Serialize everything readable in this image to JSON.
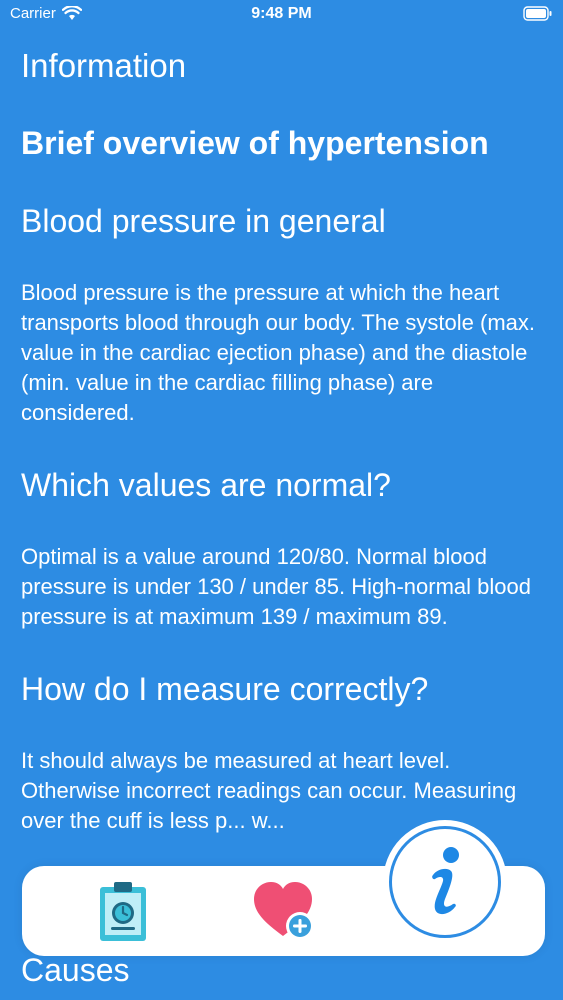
{
  "status_bar": {
    "carrier": "Carrier",
    "time": "9:48 PM",
    "wifi_icon": "wifi-icon",
    "battery_icon": "battery-icon"
  },
  "page": {
    "title": "Information",
    "subtitle": "Brief overview of hypertension",
    "sections": [
      {
        "heading": "Blood pressure in general",
        "text": "Blood pressure is the pressure at which the heart transports blood through our body. The systole (max. value in the cardiac ejection phase) and the diastole (min. value in the cardiac filling phase) are considered."
      },
      {
        "heading": "Which values are normal?",
        "text": "Optimal is a value around 120/80. Normal blood pressure is under 130 / under 85. High-normal blood pressure is at maximum 139 / maximum 89."
      },
      {
        "heading": "How do I measure correctly?",
        "text": "It should always be measured at heart level. Otherwise incorrect readings can occur. Measuring over the cuff is less p... w..."
      }
    ],
    "next_heading": "Causes"
  },
  "tab_bar": {
    "items": [
      {
        "icon": "clipboard-clock-icon"
      },
      {
        "icon": "heart-plus-icon"
      },
      {
        "icon": "info-icon"
      }
    ]
  },
  "colors": {
    "background": "#2d8ce3",
    "heart": "#ef4f74",
    "clipboard": "#3bbfd8",
    "info": "#1e88e5"
  }
}
